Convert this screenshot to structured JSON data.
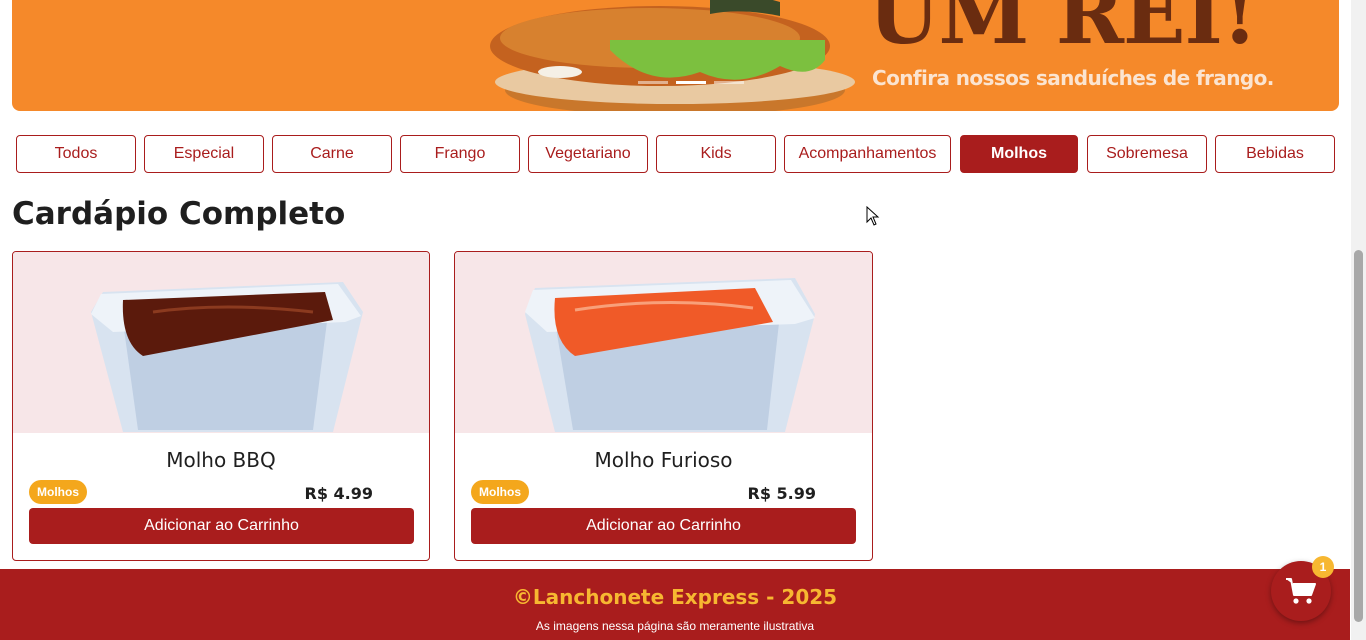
{
  "banner": {
    "headline": "UM REI!",
    "subtitle": "Confira nossos sanduíches de frango.",
    "slides": 3,
    "active_slide": 2
  },
  "filters": [
    {
      "label": "Todos",
      "active": false
    },
    {
      "label": "Especial",
      "active": false
    },
    {
      "label": "Carne",
      "active": false
    },
    {
      "label": "Frango",
      "active": false
    },
    {
      "label": "Vegetariano",
      "active": false
    },
    {
      "label": "Kids",
      "active": false
    },
    {
      "label": "Acompanhamentos",
      "active": false
    },
    {
      "label": "Molhos",
      "active": true
    },
    {
      "label": "Sobremesa",
      "active": false
    },
    {
      "label": "Bebidas",
      "active": false
    }
  ],
  "menu": {
    "title": "Cardápio Completo",
    "products": [
      {
        "name": "Molho BBQ",
        "category": "Molhos",
        "price": "R$ 4.99",
        "button": "Adicionar ao Carrinho",
        "sauce_color": "#5b1a0c"
      },
      {
        "name": "Molho Furioso",
        "category": "Molhos",
        "price": "R$ 5.99",
        "button": "Adicionar ao Carrinho",
        "sauce_color": "#f05a28"
      }
    ]
  },
  "footer": {
    "copyright": "©Lanchonete Express - 2025",
    "note": "As imagens nessa página são meramente ilustrativa"
  },
  "cart": {
    "count": "1",
    "icon": "cart-icon"
  },
  "colors": {
    "primary": "#a91d1d",
    "accent": "#f7b731",
    "banner": "#f5892a",
    "badge": "#f4a71c"
  }
}
